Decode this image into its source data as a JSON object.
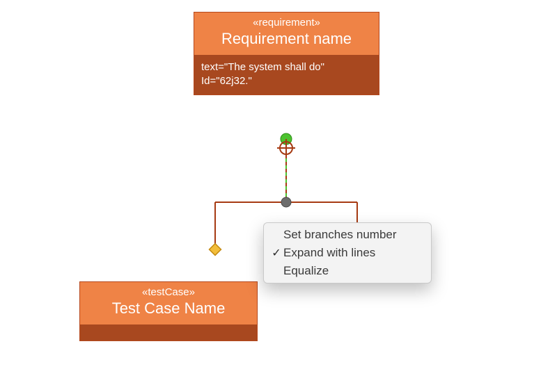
{
  "colors": {
    "node_header": "#ef8346",
    "node_body": "#a8481f",
    "node_border": "#b5471c",
    "connector": "#a63a12",
    "endpoint_green": "#4cc22f",
    "endpoint_yellow": "#f2bd3a",
    "junction_gray": "#6d6d6d"
  },
  "requirement": {
    "stereotype": "«requirement»",
    "title": "Requirement name",
    "text_line1": "text=\"The system shall do\"",
    "text_line2": "Id=\"62j32.\""
  },
  "testcase": {
    "stereotype": "«testCase»",
    "title": "Test Case Name"
  },
  "context_menu": {
    "items": [
      {
        "label": "Set branches number",
        "checked": false
      },
      {
        "label": "Expand with lines",
        "checked": true
      },
      {
        "label": "Equalize",
        "checked": false
      }
    ]
  }
}
